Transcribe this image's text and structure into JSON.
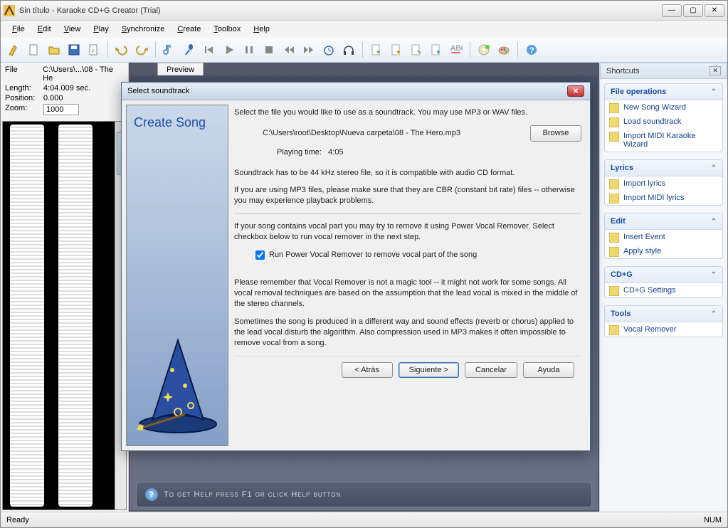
{
  "window": {
    "title": "Sin título - Karaoke CD+G Creator (Trial)"
  },
  "menu": [
    "File",
    "Edit",
    "View",
    "Play",
    "Synchronize",
    "Create",
    "Toolbox",
    "Help"
  ],
  "info": {
    "file_label": "File",
    "file_value": "C:\\Users\\...\\08 - The He",
    "length_label": "Length:",
    "length_value": "4:04.009 sec.",
    "position_label": "Position:",
    "position_value": "0.000",
    "zoom_label": "Zoom:",
    "zoom_value": "1000"
  },
  "preview_tab": "Preview",
  "help_hint": "To get Help press F1 or click Help button",
  "shortcuts": {
    "header": "Shortcuts",
    "groups": [
      {
        "title": "File operations",
        "items": [
          "New Song Wizard",
          "Load soundtrack",
          "Import MIDI Karaoke Wizard"
        ]
      },
      {
        "title": "Lyrics",
        "items": [
          "Import lyrics",
          "Import MIDI lyrics"
        ]
      },
      {
        "title": "Edit",
        "items": [
          "Insert Event",
          "Apply style"
        ]
      },
      {
        "title": "CD+G",
        "items": [
          "CD+G Settings"
        ]
      },
      {
        "title": "Tools",
        "items": [
          "Vocal Remover"
        ]
      }
    ]
  },
  "status": {
    "left": "Ready",
    "right": "NUM"
  },
  "dialog": {
    "title": "Select soundtrack",
    "side_title": "Create Song",
    "intro": "Select the file you would like to use as a soundtrack. You may use MP3 or WAV files.",
    "path": "C:\\Users\\root\\Desktop\\Nueva carpeta\\08 - The Hero.mp3",
    "browse": "Browse",
    "playing_label": "Playing time:",
    "playing_value": "4:05",
    "note1": "Soundtrack has to be 44 kHz stereo file, so it is compatible with audio CD format.",
    "note2": "If you are using MP3 files, please make sure that they are CBR (constant bit rate) files -- otherwise you may experience playback problems.",
    "vocal_intro": "If your song contains vocal part you may try to remove it using Power Vocal Remover. Select checkbox below to run vocal remover in the next step.",
    "checkbox_label": "Run Power Vocal Remover to remove vocal part of the song",
    "checkbox_checked": true,
    "warn1": "Please remember that Vocal Remover is not a magic tool -- it might not work for some songs. All vocal removal techniques are based on the assumption that the lead vocal is mixed in the middle of the stereo channels.",
    "warn2": "Sometimes the song is produced in a different way and sound effects (reverb or chorus) applied to the lead vocal disturb the algorithm. Also compression used in MP3 makes it often impossible to remove vocal from a song.",
    "buttons": {
      "back": "< Atrás",
      "next": "Siguiente >",
      "cancel": "Cancelar",
      "help": "Ayuda"
    }
  }
}
